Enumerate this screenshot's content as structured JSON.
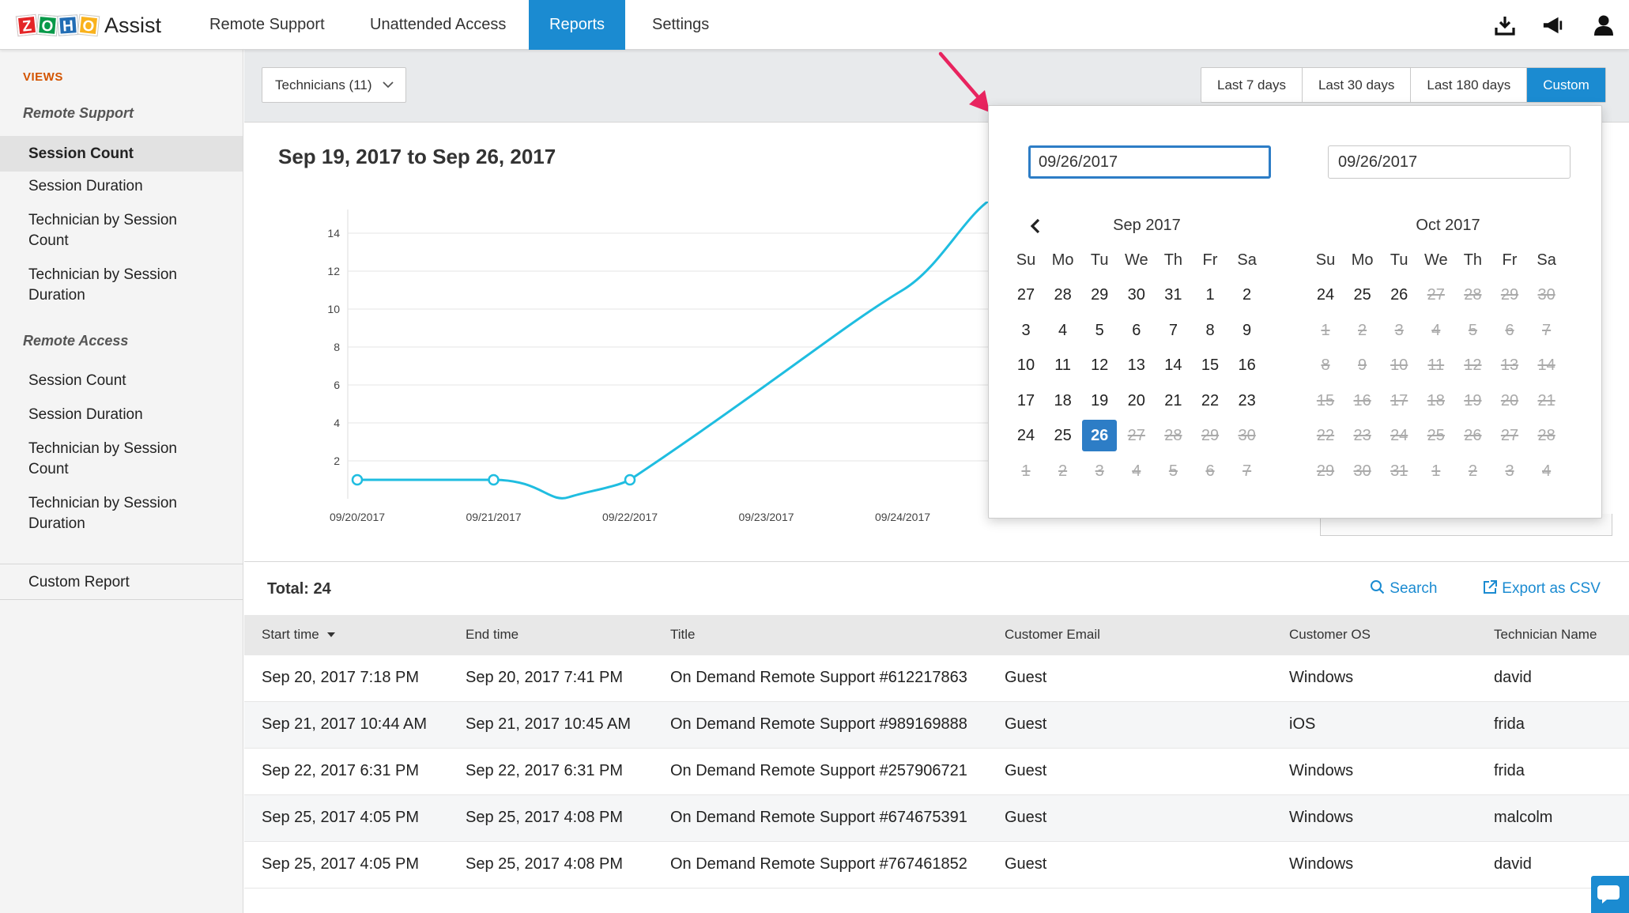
{
  "app": {
    "logo_letters": [
      "Z",
      "O",
      "H",
      "O"
    ],
    "logo_text": "Assist"
  },
  "nav": {
    "tabs": [
      {
        "label": "Remote Support"
      },
      {
        "label": "Unattended Access"
      },
      {
        "label": "Reports"
      },
      {
        "label": "Settings"
      }
    ],
    "active_tab": "Reports"
  },
  "toolbar_icons": [
    "download-icon",
    "announcement-icon",
    "user-icon"
  ],
  "sidebar": {
    "heading": "VIEWS",
    "groups": [
      {
        "label": "Remote Support",
        "items": [
          {
            "label": "Session Count",
            "active": true
          },
          {
            "label": "Session Duration"
          },
          {
            "label": "Technician by Session Count"
          },
          {
            "label": "Technician by Session Duration"
          }
        ]
      },
      {
        "label": "Remote Access",
        "items": [
          {
            "label": "Session Count"
          },
          {
            "label": "Session Duration"
          },
          {
            "label": "Technician by Session Count"
          },
          {
            "label": "Technician by Session Duration"
          }
        ]
      }
    ],
    "custom_report": "Custom Report"
  },
  "filter": {
    "technicians_select": "Technicians (11)",
    "ranges": [
      {
        "label": "Last 7 days"
      },
      {
        "label": "Last 30 days"
      },
      {
        "label": "Last 180 days"
      },
      {
        "label": "Custom",
        "active": true
      }
    ]
  },
  "report": {
    "title": "Sep 19, 2017 to Sep 26, 2017"
  },
  "chart_data": {
    "type": "line",
    "x": [
      "09/20/2017",
      "09/21/2017",
      "09/22/2017",
      "09/23/2017",
      "09/24/2017"
    ],
    "y_ticks": [
      2,
      4,
      6,
      8,
      10,
      12,
      14
    ],
    "series": [
      {
        "values": [
          1,
          1,
          1,
          6,
          11
        ]
      }
    ],
    "points_marked": [
      "09/20/2017",
      "09/21/2017",
      "09/22/2017"
    ],
    "grid": true,
    "color": "#1fbde0"
  },
  "datepicker": {
    "from": "09/26/2017",
    "to": "09/26/2017",
    "months": [
      {
        "title": "Sep 2017",
        "weeks": [
          [
            "27",
            "28",
            "29",
            "30",
            "31",
            "1",
            "2"
          ],
          [
            "3",
            "4",
            "5",
            "6",
            "7",
            "8",
            "9"
          ],
          [
            "10",
            "11",
            "12",
            "13",
            "14",
            "15",
            "16"
          ],
          [
            "17",
            "18",
            "19",
            "20",
            "21",
            "22",
            "23"
          ],
          [
            "24",
            "25",
            "26",
            "27",
            "28",
            "29",
            "30"
          ],
          [
            "1",
            "2",
            "3",
            "4",
            "5",
            "6",
            "7"
          ]
        ],
        "selected": "26"
      },
      {
        "title": "Oct 2017",
        "weeks": [
          [
            "24",
            "25",
            "26",
            "27",
            "28",
            "29",
            "30"
          ],
          [
            "1",
            "2",
            "3",
            "4",
            "5",
            "6",
            "7"
          ],
          [
            "8",
            "9",
            "10",
            "11",
            "12",
            "13",
            "14"
          ],
          [
            "15",
            "16",
            "17",
            "18",
            "19",
            "20",
            "21"
          ],
          [
            "22",
            "23",
            "24",
            "25",
            "26",
            "27",
            "28"
          ],
          [
            "29",
            "30",
            "31",
            "1",
            "2",
            "3",
            "4"
          ]
        ]
      }
    ],
    "weekdays": [
      "Su",
      "Mo",
      "Tu",
      "We",
      "Th",
      "Fr",
      "Sa"
    ]
  },
  "table": {
    "total": "Total: 24",
    "search": "Search",
    "export": "Export as CSV",
    "columns": [
      "Start time",
      "End time",
      "Title",
      "Customer Email",
      "Customer OS",
      "Technician Name"
    ],
    "rows": [
      [
        "Sep 20, 2017 7:18 PM",
        "Sep 20, 2017 7:41 PM",
        "On Demand Remote Support #612217863",
        "Guest",
        "Windows",
        "david"
      ],
      [
        "Sep 21, 2017 10:44 AM",
        "Sep 21, 2017 10:45 AM",
        "On Demand Remote Support #989169888",
        "Guest",
        "iOS",
        "frida"
      ],
      [
        "Sep 22, 2017 6:31 PM",
        "Sep 22, 2017 6:31 PM",
        "On Demand Remote Support #257906721",
        "Guest",
        "Windows",
        "frida"
      ],
      [
        "Sep 25, 2017 4:05 PM",
        "Sep 25, 2017 4:08 PM",
        "On Demand Remote Support #674675391",
        "Guest",
        "Windows",
        "malcolm"
      ],
      [
        "Sep 25, 2017 4:05 PM",
        "Sep 25, 2017 4:08 PM",
        "On Demand Remote Support #767461852",
        "Guest",
        "Windows",
        "david"
      ]
    ]
  },
  "colors": {
    "accent": "#1b8bd1",
    "selected_day": "#2d7dc6",
    "annotation_arrow": "#e8245f",
    "sidebar_heading": "#d35400"
  }
}
